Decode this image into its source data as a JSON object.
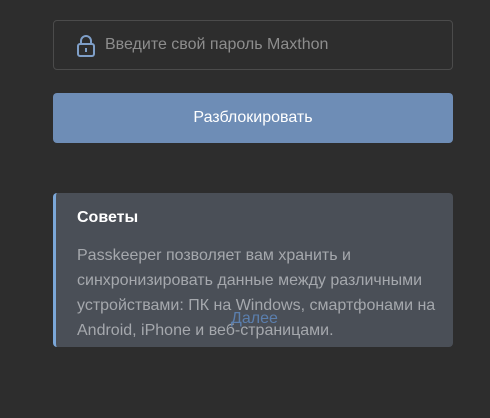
{
  "password": {
    "placeholder": "Введите свой пароль Maxthon",
    "value": "",
    "icon": "lock-icon"
  },
  "unlock_button": {
    "label": "Разблокировать"
  },
  "tips": {
    "title": "Советы",
    "text": "Passkeeper позволяет вам хранить и синхронизировать данные между различными устройствами: ПК на Windows, смартфонами на Android, iPhone и веб-страницами.",
    "more_link": "Далее"
  },
  "colors": {
    "background": "#2d2d2d",
    "button": "#6e8db6",
    "card": "#4a4f57",
    "card_accent": "#7ba7d8",
    "link": "#5b7fae"
  }
}
